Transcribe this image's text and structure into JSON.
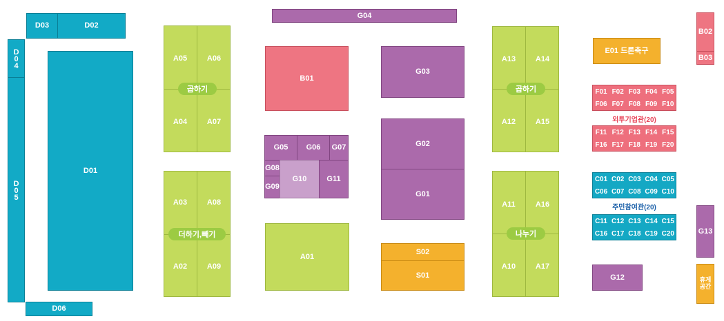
{
  "colors": {
    "cyan": "#12aac6",
    "green": "#c3db5c",
    "pink": "#ee7582",
    "purple": "#ab6aab",
    "orange": "#f4b12d",
    "caption_pink": "#e8465a",
    "caption_blue": "#1a5fa8"
  },
  "booths": {
    "D01": "D01",
    "D02": "D02",
    "D03": "D03",
    "D04": "D04",
    "D05": "D05",
    "D06": "D06",
    "A01": "A01",
    "A02": "A02",
    "A03": "A03",
    "A04": "A04",
    "A05": "A05",
    "A06": "A06",
    "A07": "A07",
    "A08": "A08",
    "A09": "A09",
    "A10": "A10",
    "A11": "A11",
    "A12": "A12",
    "A13": "A13",
    "A14": "A14",
    "A15": "A15",
    "A16": "A16",
    "A17": "A17",
    "B01": "B01",
    "B02": "B02",
    "B03": "B03",
    "G01": "G01",
    "G02": "G02",
    "G03": "G03",
    "G04": "G04",
    "G05": "G05",
    "G06": "G06",
    "G07": "G07",
    "G08": "G08",
    "G09": "G09",
    "G10": "G10",
    "G11": "G11",
    "G12": "G12",
    "G13": "G13",
    "S01": "S01",
    "S02": "S02",
    "E01": "E01 드론축구"
  },
  "zones": {
    "multiply_left": "곱하기",
    "add_subtract": "더하기,빼기",
    "multiply_right": "곱하기",
    "divide": "나누기",
    "rest_area": "휴게\n공간"
  },
  "f_group": {
    "rows_top": [
      [
        "F01",
        "F02",
        "F03",
        "F04",
        "F05"
      ],
      [
        "F06",
        "F07",
        "F08",
        "F09",
        "F10"
      ]
    ],
    "caption": "외투기업관(20)",
    "rows_bottom": [
      [
        "F11",
        "F12",
        "F13",
        "F14",
        "F15"
      ],
      [
        "F16",
        "F17",
        "F18",
        "F19",
        "F20"
      ]
    ]
  },
  "c_group": {
    "rows_top": [
      [
        "C01",
        "C02",
        "C03",
        "C04",
        "C05"
      ],
      [
        "C06",
        "C07",
        "C08",
        "C09",
        "C10"
      ]
    ],
    "caption": "주민참여관(20)",
    "rows_bottom": [
      [
        "C11",
        "C12",
        "C13",
        "C14",
        "C15"
      ],
      [
        "C16",
        "C17",
        "C18",
        "C19",
        "C20"
      ]
    ]
  }
}
